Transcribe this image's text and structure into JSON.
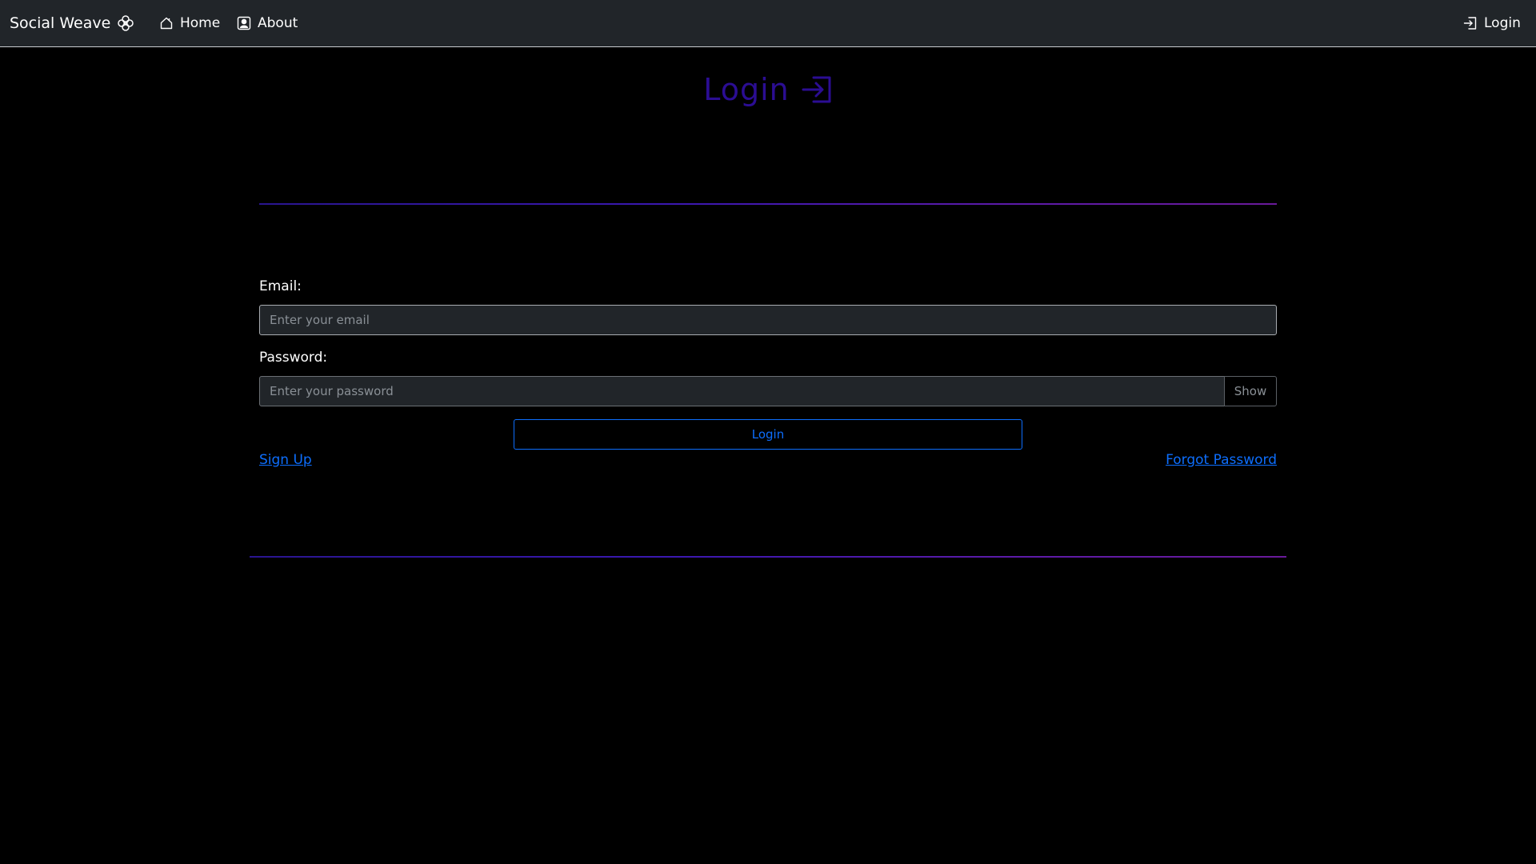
{
  "navbar": {
    "brand": "Social Weave",
    "brand_icon": "flower-icon",
    "links": {
      "home": {
        "label": "Home",
        "icon": "house-icon"
      },
      "about": {
        "label": "About",
        "icon": "person-badge-icon"
      },
      "login": {
        "label": "Login",
        "icon": "box-arrow-in-right-icon"
      }
    }
  },
  "main": {
    "title": "Login",
    "title_icon": "box-arrow-in-right-icon",
    "form": {
      "email_label": "Email:",
      "email_value": "",
      "email_placeholder": "Enter your email",
      "password_label": "Password:",
      "password_value": "",
      "password_placeholder": "Enter your password",
      "show_label": "Show",
      "submit_label": "Login"
    },
    "links": {
      "signup": "Sign Up",
      "forgot": "Forgot Password"
    }
  },
  "colors": {
    "navbar_bg": "#212529",
    "page_bg": "#000000",
    "title": "#2b0d93",
    "accent": "#0d6efd",
    "divider_start": "#2a1590",
    "divider_end": "#6a1a9a"
  }
}
